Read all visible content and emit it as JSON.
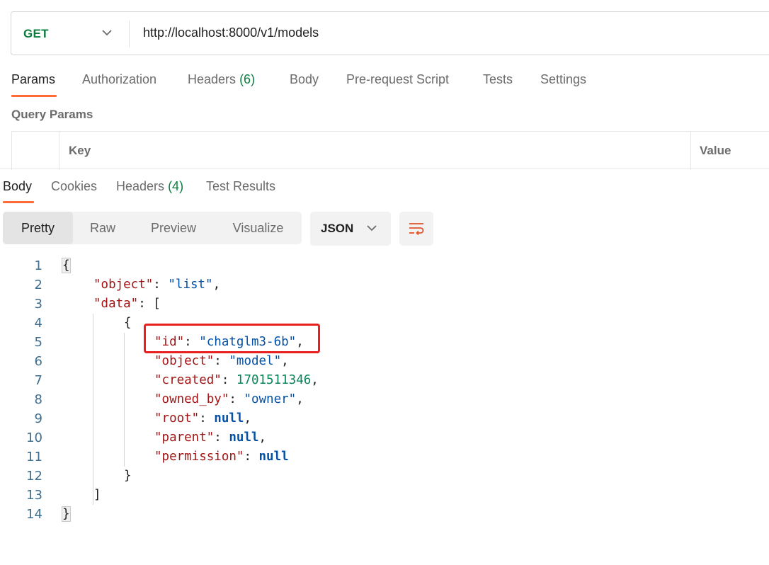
{
  "request": {
    "method": "GET",
    "url": "http://localhost:8000/v1/models",
    "tabs": [
      {
        "label": "Params",
        "count": "",
        "active": true
      },
      {
        "label": "Authorization",
        "count": "",
        "active": false
      },
      {
        "label": "Headers",
        "count": "(6)",
        "active": false
      },
      {
        "label": "Body",
        "count": "",
        "active": false
      },
      {
        "label": "Pre-request Script",
        "count": "",
        "active": false
      },
      {
        "label": "Tests",
        "count": "",
        "active": false
      },
      {
        "label": "Settings",
        "count": "",
        "active": false
      }
    ],
    "query_params_title": "Query Params",
    "table_headers": {
      "key": "Key",
      "value": "Value"
    }
  },
  "response": {
    "tabs": [
      {
        "label": "Body",
        "count": "",
        "active": true
      },
      {
        "label": "Cookies",
        "count": "",
        "active": false
      },
      {
        "label": "Headers",
        "count": "(4)",
        "active": false
      },
      {
        "label": "Test Results",
        "count": "",
        "active": false
      }
    ],
    "view_modes": [
      {
        "label": "Pretty",
        "active": true
      },
      {
        "label": "Raw",
        "active": false
      },
      {
        "label": "Preview",
        "active": false
      },
      {
        "label": "Visualize",
        "active": false
      }
    ],
    "format": "JSON",
    "icons": {
      "format_chevron": "chevron-down-icon",
      "wrap": "wrap-lines-icon"
    },
    "code_lines": [
      {
        "n": "1",
        "tokens": [
          {
            "t": "p",
            "v": "{"
          }
        ]
      },
      {
        "n": "2",
        "tokens": [
          {
            "t": "k",
            "v": "\"object\""
          },
          {
            "t": "p",
            "v": ": "
          },
          {
            "t": "s",
            "v": "\"list\""
          },
          {
            "t": "p",
            "v": ","
          }
        ]
      },
      {
        "n": "3",
        "tokens": [
          {
            "t": "k",
            "v": "\"data\""
          },
          {
            "t": "p",
            "v": ": ["
          }
        ]
      },
      {
        "n": "4",
        "tokens": [
          {
            "t": "p",
            "v": "{"
          }
        ]
      },
      {
        "n": "5",
        "tokens": [
          {
            "t": "k",
            "v": "\"id\""
          },
          {
            "t": "p",
            "v": ": "
          },
          {
            "t": "s",
            "v": "\"chatglm3-6b\""
          },
          {
            "t": "p",
            "v": ","
          }
        ]
      },
      {
        "n": "6",
        "tokens": [
          {
            "t": "k",
            "v": "\"object\""
          },
          {
            "t": "p",
            "v": ": "
          },
          {
            "t": "s",
            "v": "\"model\""
          },
          {
            "t": "p",
            "v": ","
          }
        ]
      },
      {
        "n": "7",
        "tokens": [
          {
            "t": "k",
            "v": "\"created\""
          },
          {
            "t": "p",
            "v": ": "
          },
          {
            "t": "n",
            "v": "1701511346"
          },
          {
            "t": "p",
            "v": ","
          }
        ]
      },
      {
        "n": "8",
        "tokens": [
          {
            "t": "k",
            "v": "\"owned_by\""
          },
          {
            "t": "p",
            "v": ": "
          },
          {
            "t": "s",
            "v": "\"owner\""
          },
          {
            "t": "p",
            "v": ","
          }
        ]
      },
      {
        "n": "9",
        "tokens": [
          {
            "t": "k",
            "v": "\"root\""
          },
          {
            "t": "p",
            "v": ": "
          },
          {
            "t": "nl",
            "v": "null"
          },
          {
            "t": "p",
            "v": ","
          }
        ]
      },
      {
        "n": "10",
        "tokens": [
          {
            "t": "k",
            "v": "\"parent\""
          },
          {
            "t": "p",
            "v": ": "
          },
          {
            "t": "nl",
            "v": "null"
          },
          {
            "t": "p",
            "v": ","
          }
        ]
      },
      {
        "n": "11",
        "tokens": [
          {
            "t": "k",
            "v": "\"permission\""
          },
          {
            "t": "p",
            "v": ": "
          },
          {
            "t": "nl",
            "v": "null"
          }
        ]
      },
      {
        "n": "12",
        "tokens": [
          {
            "t": "p",
            "v": "}"
          }
        ]
      },
      {
        "n": "13",
        "tokens": [
          {
            "t": "p",
            "v": "]"
          }
        ]
      },
      {
        "n": "14",
        "tokens": [
          {
            "t": "p",
            "v": "}"
          }
        ]
      }
    ],
    "highlighted_line": "5"
  }
}
